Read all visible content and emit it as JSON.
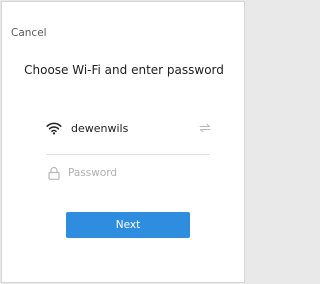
{
  "header": {
    "cancel_label": "Cancel",
    "title": "Choose Wi-Fi and enter password"
  },
  "wifi": {
    "icon": "wifi-icon",
    "ssid": "dewenwils",
    "switch_icon": "swap-arrows-icon"
  },
  "password": {
    "icon": "lock-icon",
    "placeholder": "Password",
    "value": ""
  },
  "actions": {
    "next_label": "Next"
  },
  "colors": {
    "accent": "#2f8ddf",
    "background": "#ffffff",
    "outer_background": "#e9e9e9",
    "text_primary": "#202020",
    "text_secondary": "#5a5a5a",
    "placeholder": "#b0b0b0",
    "divider": "#e2e2e2",
    "icon_muted": "#b8b8b8"
  }
}
